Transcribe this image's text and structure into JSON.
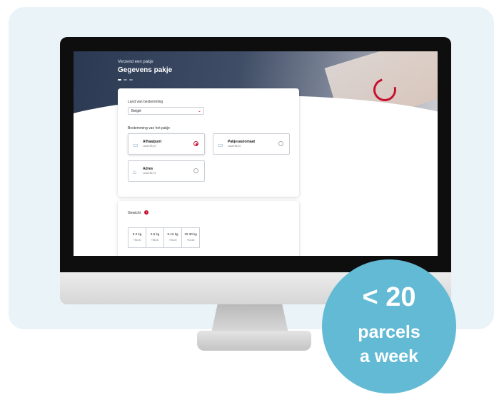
{
  "page": {
    "subtitle": "Verzend een pakje",
    "title": "Gegevens pakje"
  },
  "form": {
    "country_label": "Land van bestemming",
    "country_value": "België",
    "destination_label": "Bestemming van het pakje",
    "options": [
      {
        "title": "Afhaalpunt",
        "price": "vanaf €5,40",
        "selected": true
      },
      {
        "title": "Pakjesautomaat",
        "price": "vanaf €5,40",
        "selected": false
      },
      {
        "title": "Adres",
        "price": "vanaf €5,75",
        "selected": false
      }
    ],
    "weight_label": "Gewicht",
    "weights": [
      {
        "label": "0-2 kg",
        "price": "+€5,00"
      },
      {
        "label": "2-5 kg",
        "price": "+€8,00"
      },
      {
        "label": "5-10 kg",
        "price": "+€5,00"
      },
      {
        "label": "10-30 kg",
        "price": "+€3,60"
      }
    ]
  },
  "badge": {
    "line1": "< 20",
    "line2": "parcels",
    "line3": "a week",
    "color": "#62bad5"
  },
  "colors": {
    "accent": "#c8102e",
    "hero": "#2b3a52"
  }
}
